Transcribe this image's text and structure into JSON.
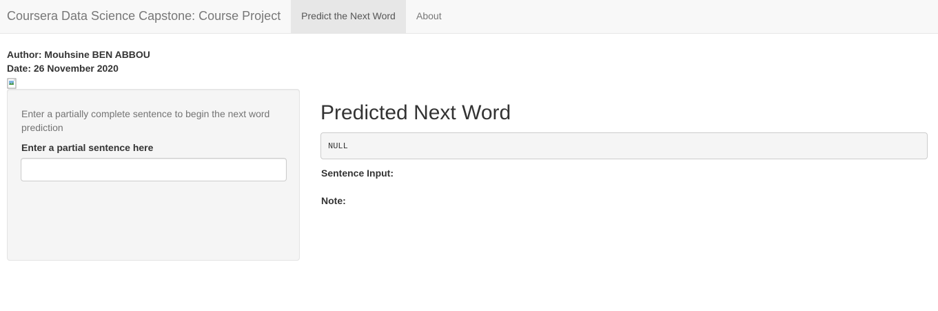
{
  "navbar": {
    "brand": "Coursera Data Science Capstone: Course Project",
    "tabs": [
      {
        "label": "Predict the Next Word",
        "active": true
      },
      {
        "label": "About",
        "active": false
      }
    ]
  },
  "header": {
    "author": "Author: Mouhsine BEN ABBOU",
    "date": "Date: 26 November 2020"
  },
  "sidebar": {
    "helper_text": "Enter a partially complete sentence to begin the next word prediction",
    "input_label": "Enter a partial sentence here",
    "input_value": "",
    "input_placeholder": ""
  },
  "main": {
    "title": "Predicted Next Word",
    "prediction": "NULL",
    "sentence_label": "Sentence Input:",
    "note_label": "Note:"
  },
  "colors": {
    "navbar_bg": "#f8f8f8",
    "active_tab_bg": "#e7e7e7",
    "well_bg": "#f5f5f5"
  }
}
